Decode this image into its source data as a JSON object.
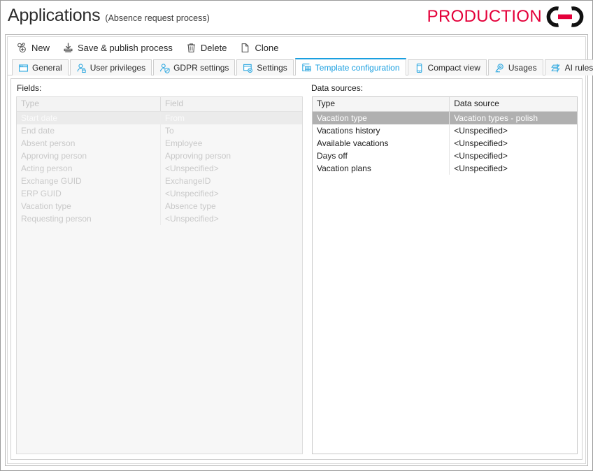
{
  "header": {
    "title": "Applications",
    "subtitle": "(Absence request process)",
    "logo_text": "PRODUCTION",
    "logo_mark_name": "chain-link-logo",
    "accent_red": "#e4003a",
    "accent_blue": "#1a9fe0"
  },
  "toolbar": {
    "items": [
      {
        "label": "New",
        "icon": "new-nodes-icon"
      },
      {
        "label": "Save & publish process",
        "icon": "save-publish-icon"
      },
      {
        "label": "Delete",
        "icon": "trash-icon"
      },
      {
        "label": "Clone",
        "icon": "copy-page-icon"
      }
    ]
  },
  "tabs": [
    {
      "label": "General",
      "icon": "window-icon",
      "active": false
    },
    {
      "label": "User privileges",
      "icon": "user-lock-icon",
      "active": false
    },
    {
      "label": "GDPR settings",
      "icon": "user-shield-icon",
      "active": false
    },
    {
      "label": "Settings",
      "icon": "window-gear-icon",
      "active": false
    },
    {
      "label": "Template configuration",
      "icon": "window-grid-icon",
      "active": true
    },
    {
      "label": "Compact view",
      "icon": "phone-icon",
      "active": false
    },
    {
      "label": "Usages",
      "icon": "usages-icon",
      "active": false
    },
    {
      "label": "AI rules",
      "icon": "ai-rules-icon",
      "active": false
    }
  ],
  "fields_panel": {
    "label": "Fields:",
    "disabled": true,
    "columns": [
      "Type",
      "Field"
    ],
    "rows": [
      {
        "type": "Start date",
        "field": "From",
        "selected": true
      },
      {
        "type": "End date",
        "field": "To",
        "selected": false
      },
      {
        "type": "Absent person",
        "field": "Employee",
        "selected": false
      },
      {
        "type": "Approving person",
        "field": "Approving person",
        "selected": false
      },
      {
        "type": "Acting person",
        "field": "<Unspecified>",
        "selected": false
      },
      {
        "type": "Exchange GUID",
        "field": "ExchangeID",
        "selected": false
      },
      {
        "type": "ERP GUID",
        "field": "<Unspecified>",
        "selected": false
      },
      {
        "type": "Vacation type",
        "field": "Absence type",
        "selected": false
      },
      {
        "type": "Requesting person",
        "field": "<Unspecified>",
        "selected": false
      }
    ]
  },
  "data_sources_panel": {
    "label": "Data sources:",
    "disabled": false,
    "columns": [
      "Type",
      "Data source"
    ],
    "rows": [
      {
        "type": "Vacation type",
        "source": "Vacation types - polish",
        "selected": true
      },
      {
        "type": "Vacations history",
        "source": "<Unspecified>",
        "selected": false
      },
      {
        "type": "Available vacations",
        "source": "<Unspecified>",
        "selected": false
      },
      {
        "type": "Days off",
        "source": "<Unspecified>",
        "selected": false
      },
      {
        "type": "Vacation plans",
        "source": "<Unspecified>",
        "selected": false
      }
    ]
  }
}
